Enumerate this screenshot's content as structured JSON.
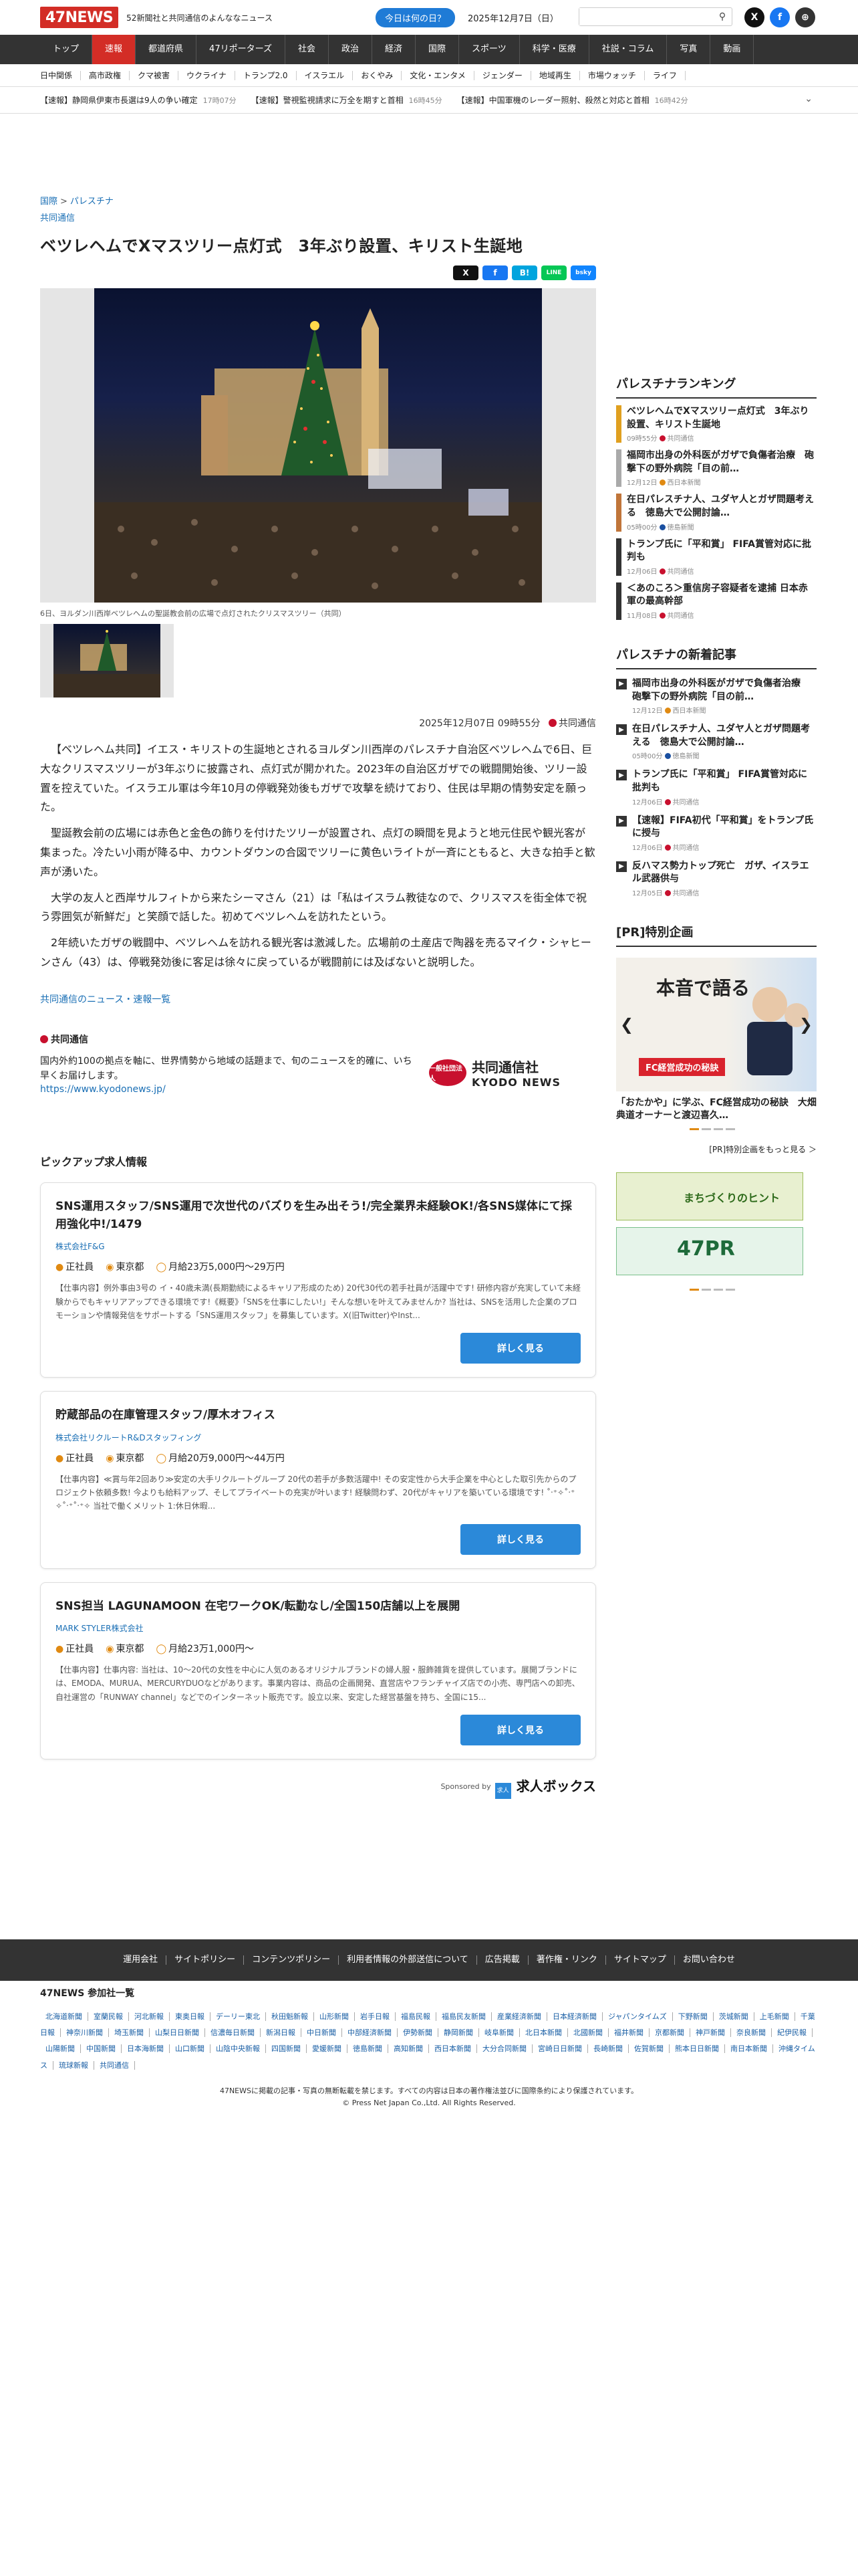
{
  "header": {
    "logo": "47NEWS",
    "tagline": "52新聞社と共同通信のよんななニュース",
    "today_button": "今日は何の日？",
    "date": "2025年12月7日（日）",
    "search_placeholder": "",
    "sns": [
      "X",
      "f",
      "⊕"
    ]
  },
  "nav": {
    "items": [
      "トップ",
      "速報",
      "都道府県",
      "47リポーターズ",
      "社会",
      "政治",
      "経済",
      "国際",
      "スポーツ",
      "科学・医療",
      "社説・コラム",
      "写真",
      "動画"
    ],
    "active_index": 1
  },
  "subnav": [
    "日中関係",
    "高市政権",
    "クマ被害",
    "ウクライナ",
    "トランプ2.0",
    "イスラエル",
    "おくやみ",
    "文化・エンタメ",
    "ジェンダー",
    "地域再生",
    "市場ウォッチ",
    "ライフ"
  ],
  "ticker": [
    {
      "text": "【速報】静岡県伊東市長選は9人の争い確定",
      "time": "17時07分"
    },
    {
      "text": "【速報】警視監視請求に万全を期すと首相",
      "time": "16時45分"
    },
    {
      "text": "【速報】中国軍機のレーダー照射、殺然と対応と首相",
      "time": "16時42分"
    }
  ],
  "article": {
    "breadcrumb": [
      "国際",
      "パレスチナ"
    ],
    "category": "共同通信",
    "headline": "ベツレヘムでXマスツリー点灯式　3年ぶり設置、キリスト生誕地",
    "share_buttons": [
      "X",
      "f",
      "B!",
      "LINE",
      "bsky"
    ],
    "caption": "6日、ヨルダン川西岸ベツレヘムの聖誕教会前の広場で点灯されたクリスマスツリー（共同）",
    "datetime": "2025年12月07日 09時55分",
    "source": "共同通信",
    "paragraphs": [
      "【ベツレヘム共同】イエス・キリストの生誕地とされるヨルダン川西岸のパレスチナ自治区ベツレヘムで6日、巨大なクリスマスツリーが3年ぶりに披露され、点灯式が開かれた。2023年の自治区ガザでの戦闘開始後、ツリー設置を控えていた。イスラエル軍は今年10月の停戦発効後もガザで攻撃を続けており、住民は早期の情勢安定を願った。",
      "聖誕教会前の広場には赤色と金色の飾りを付けたツリーが設置され、点灯の瞬間を見ようと地元住民や観光客が集まった。冷たい小雨が降る中、カウントダウンの合図でツリーに黄色いライトが一斉にともると、大きな拍手と歓声が湧いた。",
      "大学の友人と西岸サルフィトから来たシーマさん（21）は「私はイスラム教徒なので、クリスマスを街全体で祝う雰囲気が新鮮だ」と笑顔で話した。初めてベツレヘムを訪れたという。",
      "2年続いたガザの戦闘中、ベツレヘムを訪れる観光客は激減した。広場前の土産店で陶器を売るマイク・シャヒーンさん（43）は、停戦発効後に客足は徐々に戻っているが戦闘前には及ばないと説明した。"
    ],
    "more_link": "共同通信のニュース・速報一覧"
  },
  "kyodo": {
    "title": "共同通信",
    "desc": "国内外約100の拠点を軸に、世界情勢から地域の話題まで、旬のニュースを的確に、いち早くお届けします。",
    "url": "https://www.kyodonews.jp/",
    "logo_mark": "一般社団法人",
    "logo_jp": "共同通信社",
    "logo_en": "KYODO NEWS"
  },
  "jobs": {
    "section_title": "ピックアップ求人情報",
    "items": [
      {
        "title": "SNS運用スタッフ/SNS運用で次世代のバズりを生み出そう!/完全業界未経験OK!/各SNS媒体にて採用強化中!/1479",
        "company": "株式会社F&G",
        "type": "正社員",
        "location": "東京都",
        "salary": "月給23万5,000円～29万円",
        "desc": "【仕事内容】例外事由3号の イ・40歳未満(長期勤続によるキャリア形成のため) 20代30代の若手社員が活躍中です! 研修内容が充実していて未経験からでもキャリアアップできる環境です!《概要》「SNSを仕事にしたい!」そんな想いを叶えてみませんか? 当社は、SNSを活用した企業のプロモーションや情報発信をサポートする「SNS運用スタッフ」を募集しています。X(旧Twitter)やInst..."
      },
      {
        "title": "貯蔵部品の在庫管理スタッフ/厚木オフィス",
        "company": "株式会社リクルートR&Dスタッフィング",
        "type": "正社員",
        "location": "東京都",
        "salary": "月給20万9,000円～44万円",
        "desc": "【仕事内容】≪賞与年2回あり≫安定の大手リクルートグループ 20代の若手が多数活躍中! その安定性から大手企業を中心とした取引先からのプロジェクト依頼多数! 今よりも給料アップ、そしてプライベートの充実が叶います! 経験問わず、20代がキャリアを築いている環境です! ˚‧⁺✧˚‧⁺ ✧˚‧⁺˚‧⁺✧ 当社で働くメリット 1:休日休暇..."
      },
      {
        "title": "SNS担当 LAGUNAMOON 在宅ワークOK/転勤なし/全国150店舗以上を展開",
        "company": "MARK STYLER株式会社",
        "type": "正社員",
        "location": "東京都",
        "salary": "月給23万1,000円～",
        "desc": "【仕事内容】仕事内容: 当社は、10～20代の女性を中心に人気のあるオリジナルブランドの婦人服・服飾雑貨を提供しています。展開ブランドには、EMODA、MURUA、MERCURYDUOなどがあります。事業内容は、商品の企画開発、直営店やフランチャイズ店での小売、専門店への卸売、自社運営の「RUNWAY channel」などでのインターネット販売です。設立以来、安定した経営基盤を持ち、全国に15..."
      }
    ],
    "detail_button": "詳しく見る",
    "sponsored": "Sponsored by",
    "sponsor_box": "求人",
    "sponsor_name": "求人ボックス"
  },
  "sidebar": {
    "ranking_title": "パレスチナランキング",
    "ranking": [
      {
        "title": "ベツレヘムでXマスツリー点灯式　3年ぶり設置、キリスト生誕地",
        "time": "09時55分",
        "source": "共同通信",
        "color": "#e0a020"
      },
      {
        "title": "福岡市出身の外科医がガザで負傷者治療　砲撃下の野外病院「目の前…",
        "time": "12月12日",
        "source": "西日本新聞",
        "color": "#aaaaaa"
      },
      {
        "title": "在日パレスチナ人、ユダヤ人とガザ問題考える　徳島大で公開討論…",
        "time": "05時00分",
        "source": "徳島新聞",
        "color": "#c0753a"
      },
      {
        "title": "トランプ氏に「平和賞」 FIFA賞管対応に批判も",
        "time": "12月06日",
        "source": "共同通信",
        "color": "#333333"
      },
      {
        "title": "＜あのころ＞重信房子容疑者を逮捕 日本赤軍の最高幹部",
        "time": "11月08日",
        "source": "共同通信",
        "color": "#333333"
      }
    ],
    "new_title": "パレスチナの新着記事",
    "new_articles": [
      {
        "title": "福岡市出身の外科医がガザで負傷者治療　砲撃下の野外病院「目の前…",
        "time": "12月12日",
        "source": "西日本新聞"
      },
      {
        "title": "在日パレスチナ人、ユダヤ人とガザ問題考える　徳島大で公開討論…",
        "time": "05時00分",
        "source": "徳島新聞"
      },
      {
        "title": "トランプ氏に「平和賞」 FIFA賞管対応に批判も",
        "time": "12月06日",
        "source": "共同通信"
      },
      {
        "title": "【速報】FIFA初代「平和賞」をトランプ氏に授与",
        "time": "12月06日",
        "source": "共同通信"
      },
      {
        "title": "反ハマス勢力トップ死亡　ガザ、イスラエル武器供与",
        "time": "12月05日",
        "source": "共同通信"
      }
    ],
    "pr_title": "[PR]特別企画",
    "pr_img_big": "本音で語る",
    "pr_img_sub": "FC経営成功の秘訣",
    "pr_caption": "「おたかや」に学ぶ、FC経営成功の秘訣　大畑典道オーナーと渡辺喜久…",
    "pr_more": "[PR]特別企画をもっと見る ＞",
    "banner1": "まちづくりのヒント",
    "banner2": "47PR"
  },
  "footer": {
    "links": [
      "運用会社",
      "サイトポリシー",
      "コンテンツポリシー",
      "利用者情報の外部送信について",
      "広告掲載",
      "著作権・リンク",
      "サイトマップ",
      "お問い合わせ"
    ],
    "papers_title": "47NEWS 参加社一覧",
    "papers": [
      "北海道新聞",
      "室蘭民報",
      "河北新報",
      "東奥日報",
      "デーリー東北",
      "秋田魁新報",
      "山形新聞",
      "岩手日報",
      "福島民報",
      "福島民友新聞",
      "産業経済新聞",
      "日本経済新聞",
      "ジャパンタイムズ",
      "下野新聞",
      "茨城新聞",
      "上毛新聞",
      "千葉日報",
      "神奈川新聞",
      "埼玉新聞",
      "山梨日日新聞",
      "信濃毎日新聞",
      "新潟日報",
      "中日新聞",
      "中部経済新聞",
      "伊勢新聞",
      "静岡新聞",
      "岐阜新聞",
      "北日本新聞",
      "北國新聞",
      "福井新聞",
      "京都新聞",
      "神戸新聞",
      "奈良新聞",
      "紀伊民報",
      "山陽新聞",
      "中国新聞",
      "日本海新聞",
      "山口新聞",
      "山陰中央新報",
      "四国新聞",
      "愛媛新聞",
      "徳島新聞",
      "高知新聞",
      "西日本新聞",
      "大分合同新聞",
      "宮崎日日新聞",
      "長崎新聞",
      "佐賀新聞",
      "熊本日日新聞",
      "南日本新聞",
      "沖縄タイムス",
      "琉球新報",
      "共同通信"
    ],
    "copyright1": "47NEWSに掲載の記事・写真の無断転載を禁じます。すべての内容は日本の著作権法並びに国際条約により保護されています。",
    "copyright2": "© Press Net Japan Co.,Ltd. All Rights Reserved."
  }
}
